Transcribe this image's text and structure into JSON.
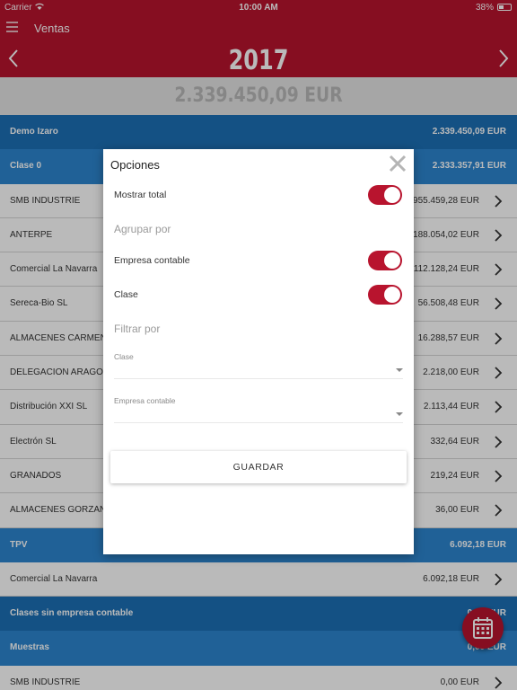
{
  "status_bar": {
    "carrier": "Carrier",
    "time": "10:00 AM",
    "battery": "38%"
  },
  "app_bar": {
    "title": "Ventas"
  },
  "year_bar": {
    "year": "2017"
  },
  "total_bar": {
    "total": "2.339.450,09 EUR"
  },
  "list": [
    {
      "type": "group",
      "name": "Demo Izaro",
      "amount": "2.339.450,09 EUR"
    },
    {
      "type": "sub",
      "name": "Clase 0",
      "amount": "2.333.357,91 EUR"
    },
    {
      "type": "item",
      "name": "SMB INDUSTRIE",
      "amount": "955.459,28 EUR"
    },
    {
      "type": "item",
      "name": "ANTERPE",
      "amount": "188.054,02 EUR"
    },
    {
      "type": "item",
      "name": "Comercial La Navarra",
      "amount": "112.128,24 EUR"
    },
    {
      "type": "item",
      "name": "Sereca-Bio SL",
      "amount": "56.508,48 EUR"
    },
    {
      "type": "item",
      "name": "ALMACENES CARMEN",
      "amount": "16.288,57 EUR"
    },
    {
      "type": "item",
      "name": "DELEGACION ARAGON",
      "amount": "2.218,00 EUR"
    },
    {
      "type": "item",
      "name": "Distribución XXI SL",
      "amount": "2.113,44 EUR"
    },
    {
      "type": "item",
      "name": "Electrón SL",
      "amount": "332,64 EUR"
    },
    {
      "type": "item",
      "name": "GRANADOS",
      "amount": "219,24 EUR"
    },
    {
      "type": "item",
      "name": "ALMACENES GORZAN",
      "amount": "36,00 EUR"
    },
    {
      "type": "sub",
      "name": "TPV",
      "amount": "6.092,18 EUR"
    },
    {
      "type": "item",
      "name": "Comercial La Navarra",
      "amount": "6.092,18 EUR"
    },
    {
      "type": "group",
      "name": "Clases sin empresa contable",
      "amount": "0,00 EUR"
    },
    {
      "type": "sub",
      "name": "Muestras",
      "amount": "0,00 EUR"
    },
    {
      "type": "item",
      "name": "SMB INDUSTRIE",
      "amount": "0,00 EUR"
    }
  ],
  "dialog": {
    "title": "Opciones",
    "show_total_label": "Mostrar total",
    "show_total_on": true,
    "group_by_label": "Agrupar por",
    "company_label": "Empresa contable",
    "company_on": true,
    "class_label": "Clase",
    "class_on": true,
    "filter_by_label": "Filtrar por",
    "class_filter_label": "Clase",
    "class_filter_value": "",
    "company_filter_label": "Empresa contable",
    "company_filter_value": "",
    "save_label": "GUARDAR"
  },
  "colors": {
    "primary": "#b8142e",
    "group": "#1c6fb5",
    "sub": "#2c86cf"
  },
  "icons": [
    "menu-icon",
    "chevron-left-icon",
    "chevron-right-icon",
    "close-icon",
    "calendar-icon"
  ]
}
